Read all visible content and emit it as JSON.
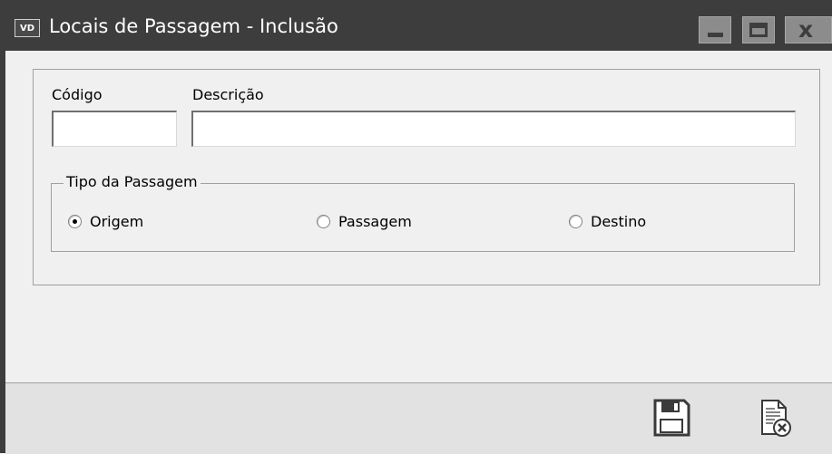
{
  "window": {
    "title": "Locais de Passagem - Inclusão",
    "icon": "VD"
  },
  "form": {
    "codigo_label": "Código",
    "codigo_value": "",
    "descricao_label": "Descrição",
    "descricao_value": "",
    "tipo_group_label": "Tipo da Passagem",
    "radios": [
      {
        "label": "Origem",
        "checked": true
      },
      {
        "label": "Passagem",
        "checked": false
      },
      {
        "label": "Destino",
        "checked": false
      }
    ]
  },
  "toolbar": {
    "save_icon": "save-icon",
    "cancel_icon": "cancel-document-icon"
  }
}
